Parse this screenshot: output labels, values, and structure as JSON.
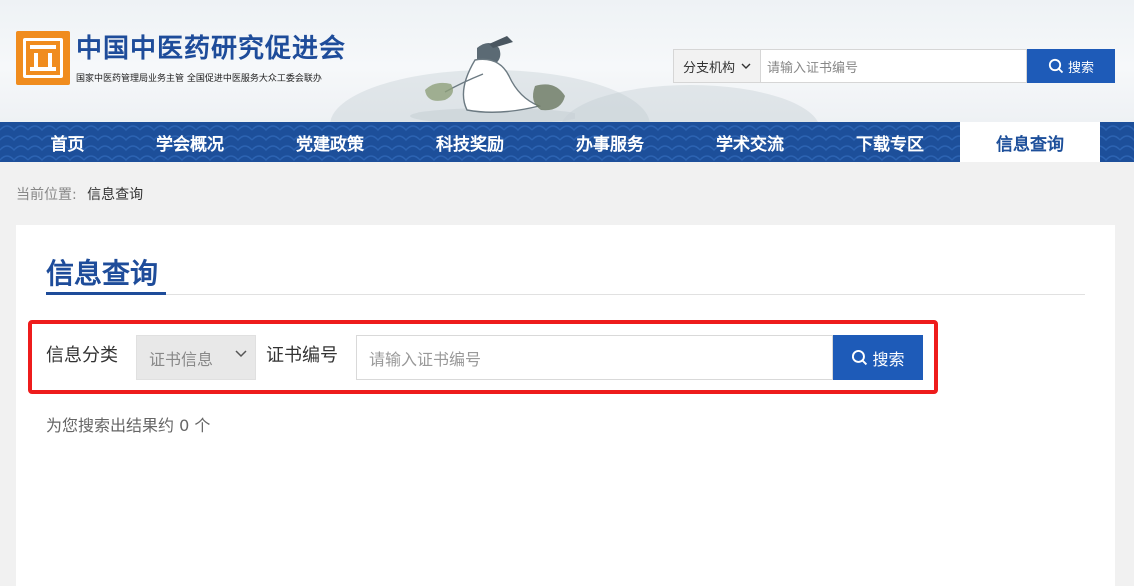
{
  "header": {
    "site_title": "中国中医药研究促进会",
    "site_subtitle": "国家中医药管理局业务主管 全国促进中医服务大众工委会联办",
    "top_search": {
      "select_value": "分支机构",
      "placeholder": "请输入证书编号",
      "button_label": "搜索"
    }
  },
  "nav": {
    "items": [
      "首页",
      "学会概况",
      "党建政策",
      "科技奖励",
      "办事服务",
      "学术交流",
      "下载专区",
      "信息查询"
    ],
    "active_index": 7
  },
  "breadcrumb": {
    "prefix": "当前位置:",
    "current": "信息查询"
  },
  "main": {
    "title": "信息查询",
    "form": {
      "category_label": "信息分类",
      "category_value": "证书信息",
      "cert_label": "证书编号",
      "cert_placeholder": "请输入证书编号",
      "button_label": "搜索"
    },
    "result_text": "为您搜索出结果约 0 个"
  },
  "colors": {
    "brand_blue": "#1e4c9a",
    "button_blue": "#1e5bb8",
    "highlight_red": "#ee1c1c",
    "logo_orange": "#f08c1e"
  }
}
